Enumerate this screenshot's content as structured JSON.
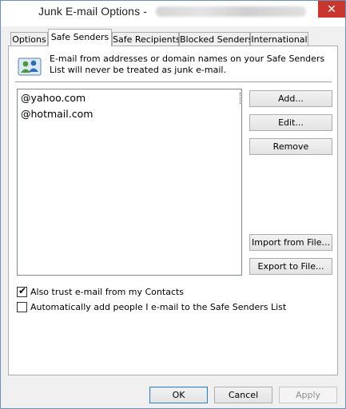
{
  "window": {
    "title": "Junk E-mail Options -",
    "close_glyph": "✕"
  },
  "tabs": [
    {
      "label": "Options"
    },
    {
      "label": "Safe Senders"
    },
    {
      "label": "Safe Recipients"
    },
    {
      "label": "Blocked Senders"
    },
    {
      "label": "International"
    }
  ],
  "active_tab": "Safe Senders",
  "panel": {
    "icon": "contacts-icon",
    "info_text": "E-mail from addresses or domain names on your Safe Senders List will never be treated as junk e-mail.",
    "list_items": [
      "@yahoo.com",
      "@hotmail.com"
    ],
    "buttons": {
      "add": "Add...",
      "edit": "Edit...",
      "remove": "Remove",
      "import": "Import from File...",
      "export": "Export to File..."
    },
    "checkboxes": [
      {
        "label": "Also trust e-mail from my Contacts",
        "checked": true
      },
      {
        "label": "Automatically add people I e-mail to the Safe Senders List",
        "checked": false
      }
    ]
  },
  "footer": {
    "ok": "OK",
    "cancel": "Cancel",
    "apply": "Apply",
    "apply_enabled": false
  }
}
